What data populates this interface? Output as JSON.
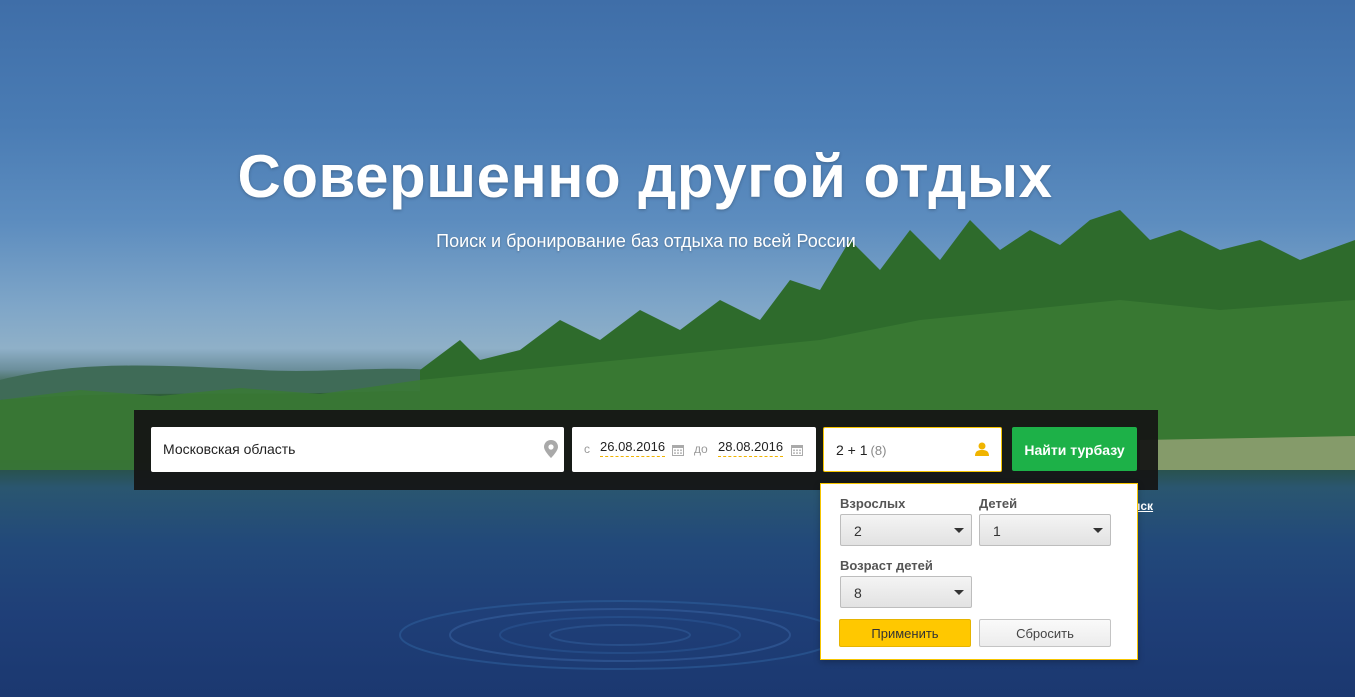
{
  "hero": {
    "title": "Совершенно другой отдых",
    "subtitle": "Поиск и бронирование баз отдыха по всей России"
  },
  "search": {
    "location_value": "Московская область",
    "date_from_label": "с",
    "date_from": "26.08.2016",
    "date_to_label": "до",
    "date_to": "28.08.2016",
    "guests_value": "2 + 1",
    "guests_ages": "(8)",
    "find_label": "Найти турбазу",
    "partial_link": "иск",
    "icons": {
      "location": "map-pin-icon",
      "calendar": "calendar-icon",
      "guests": "person-icon"
    },
    "colors": {
      "find_button": "#1db148",
      "accent": "#ffc800"
    }
  },
  "guests_popup": {
    "adults_label": "Взрослых",
    "adults_value": "2",
    "children_label": "Детей",
    "children_value": "1",
    "children_age_label": "Возраст детей",
    "children_age_value": "8",
    "apply_label": "Применить",
    "reset_label": "Сбросить"
  }
}
